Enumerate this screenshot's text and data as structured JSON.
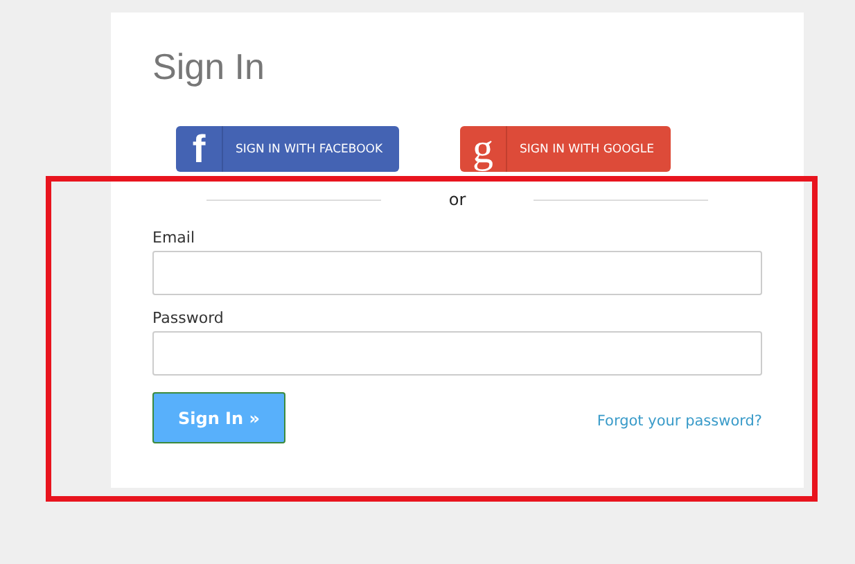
{
  "title": "Sign In",
  "social_buttons": [
    {
      "kind": "facebook",
      "icon": "f",
      "label": "SIGN IN WITH FACEBOOK"
    },
    {
      "kind": "google",
      "icon": "g",
      "label": "SIGN IN WITH GOOGLE"
    }
  ],
  "separator": "or",
  "fields": [
    {
      "label": "Email"
    },
    {
      "label": "Password"
    }
  ],
  "submit": "Sign In »",
  "forgot_link": "Forgot your password?"
}
